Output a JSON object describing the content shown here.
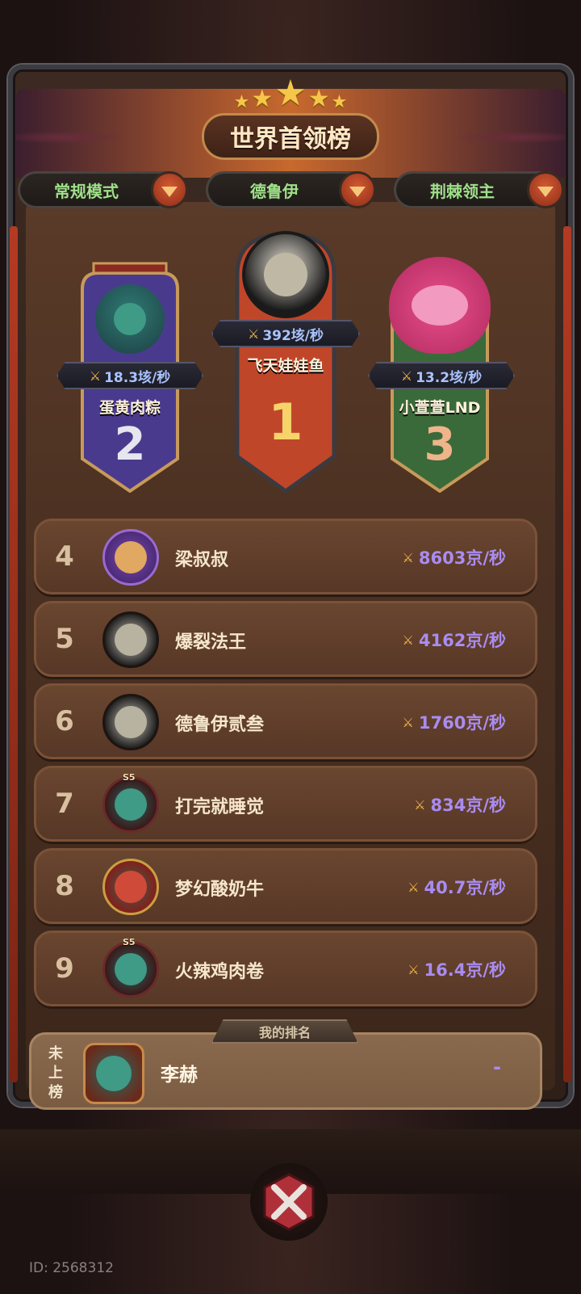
{
  "title": "世界首领榜",
  "filters": [
    {
      "label": "常规模式"
    },
    {
      "label": "德鲁伊"
    },
    {
      "label": "荆棘领主"
    }
  ],
  "podium": [
    {
      "rank": "1",
      "name": "飞天娃娃鱼",
      "score": "392垓/秒",
      "color": "#c0462a"
    },
    {
      "rank": "2",
      "name": "蛋黄肉粽",
      "score": "18.3垓/秒",
      "color": "#4a3a8e"
    },
    {
      "rank": "3",
      "name": "小萱萱LND",
      "score": "13.2垓/秒",
      "color": "#3a6a3a"
    }
  ],
  "rows": [
    {
      "rank": "4",
      "name": "梁叔叔",
      "score": "8603京/秒",
      "avatar_icon": "cat-mage-icon"
    },
    {
      "rank": "5",
      "name": "爆裂法王",
      "score": "4162京/秒",
      "avatar_icon": "druid-icon"
    },
    {
      "rank": "6",
      "name": "德鲁伊贰叁",
      "score": "1760京/秒",
      "avatar_icon": "druid-icon"
    },
    {
      "rank": "7",
      "name": "打完就睡觉",
      "score": "834京/秒",
      "avatar_icon": "knight-icon",
      "badge": "S5"
    },
    {
      "rank": "8",
      "name": "梦幻酸奶牛",
      "score": "40.7京/秒",
      "avatar_icon": "festive-icon"
    },
    {
      "rank": "9",
      "name": "火辣鸡肉卷",
      "score": "16.4京/秒",
      "avatar_icon": "knight-icon",
      "badge": "S5"
    }
  ],
  "my_rank": {
    "tab_label": "我的排名",
    "status": "未上榜",
    "name": "李赫",
    "score": "-"
  },
  "player_id": "ID: 2568312"
}
